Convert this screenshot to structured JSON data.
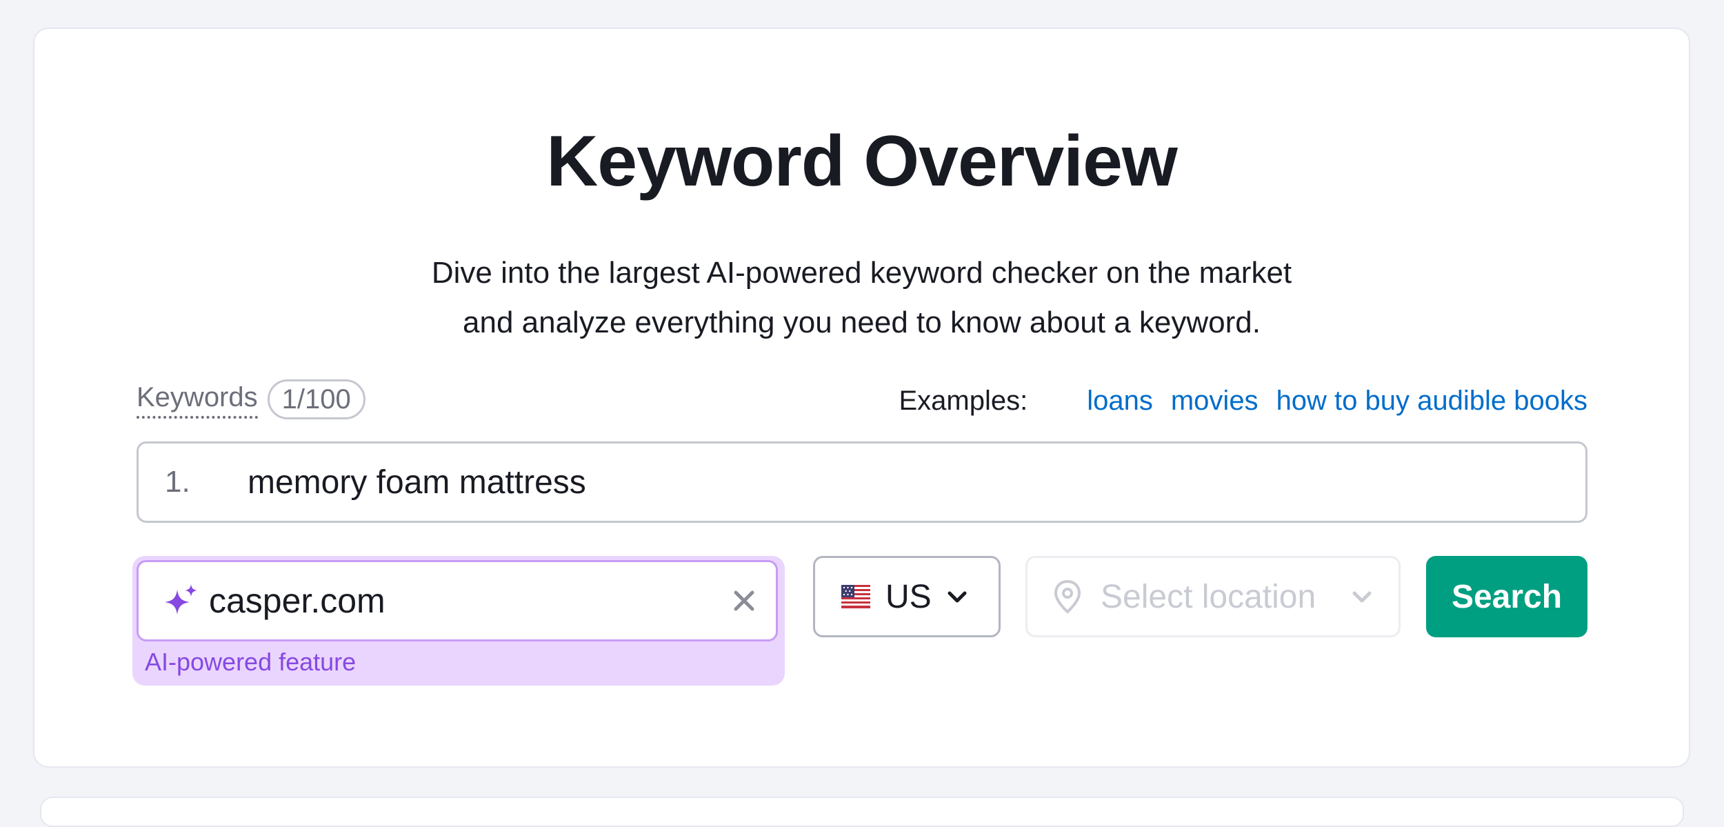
{
  "header": {
    "title": "Keyword Overview",
    "subtitle_line1": "Dive into the largest AI-powered keyword checker on the market",
    "subtitle_line2": "and analyze everything you need to know about a keyword."
  },
  "keywords": {
    "label": "Keywords",
    "counter": "1/100",
    "rows": [
      {
        "number": "1.",
        "value": "memory foam mattress"
      }
    ]
  },
  "examples": {
    "label": "Examples:",
    "links": [
      "loans",
      "movies",
      "how to buy audible books"
    ]
  },
  "domain": {
    "value": "casper.com",
    "caption": "AI-powered feature",
    "icon": "sparkle-icon",
    "clear_icon": "close-icon"
  },
  "database": {
    "value": "US",
    "flag": "us-flag-icon"
  },
  "location": {
    "placeholder": "Select location"
  },
  "search": {
    "label": "Search"
  },
  "colors": {
    "accent_green": "#009f81",
    "link_blue": "#006dca",
    "ai_purple": "#8649e1",
    "ai_background": "#ead5ff"
  }
}
